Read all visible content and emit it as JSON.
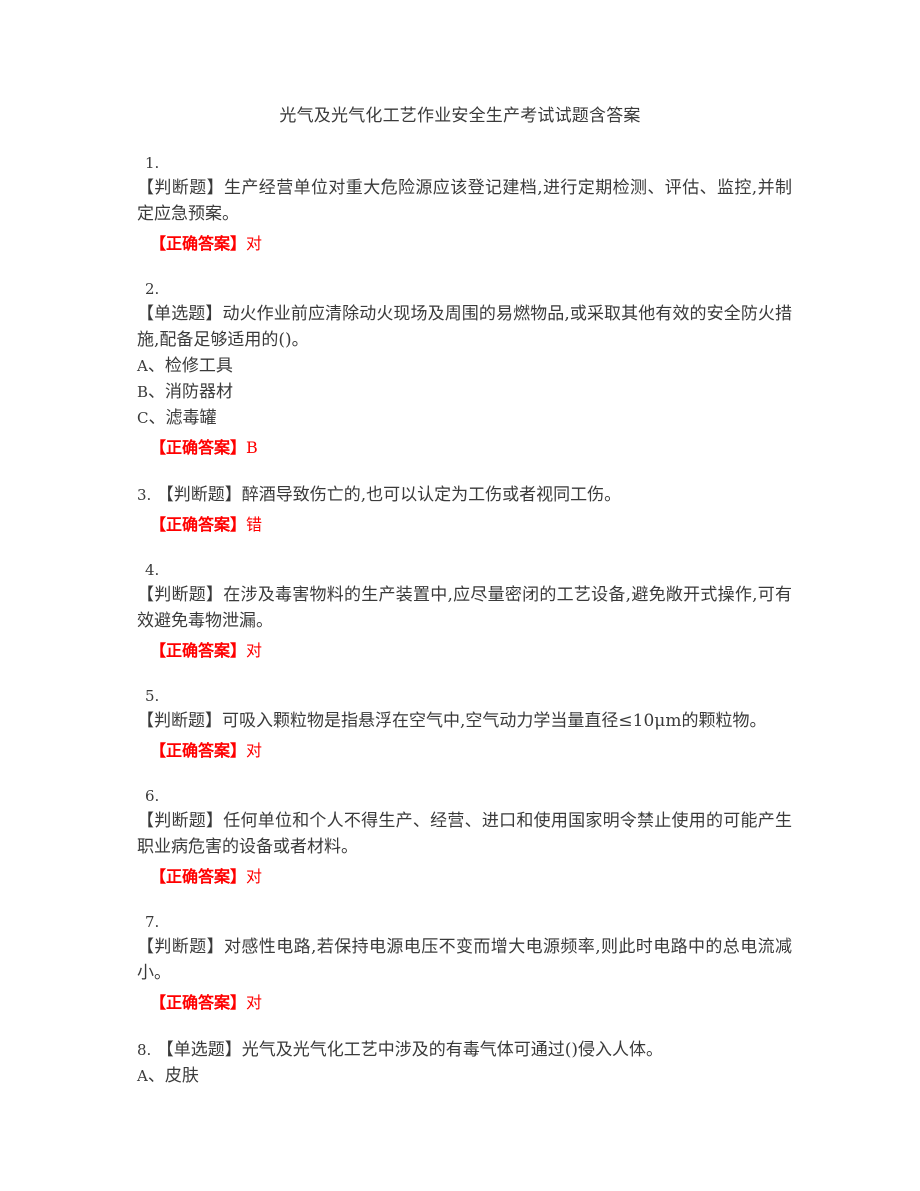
{
  "document": {
    "title": "光气及光气化工艺作业安全生产考试试题含答案",
    "answer_label": "【正确答案】",
    "accent_color": "#ff0000",
    "text_color": "#3a3a3a",
    "background_color": "#ffffff"
  },
  "questions": [
    {
      "number": "1.",
      "inline": false,
      "type_tag": "【判断题】",
      "text": "生产经营单位对重大危险源应该登记建档,进行定期检测、评估、监控,并制定应急预案。",
      "options": [],
      "answer": "对"
    },
    {
      "number": "2.",
      "inline": false,
      "type_tag": "【单选题】",
      "text": "动火作业前应清除动火现场及周围的易燃物品,或采取其他有效的安全防火措施,配备足够适用的()。",
      "options": [
        {
          "letter": "A",
          "separator": "、",
          "label": "检修工具"
        },
        {
          "letter": "B",
          "separator": "、",
          "label": "消防器材"
        },
        {
          "letter": "C",
          "separator": "、",
          "label": "滤毒罐"
        }
      ],
      "answer": "B"
    },
    {
      "number": "3.",
      "inline": true,
      "type_tag": "【判断题】",
      "text": "醉酒导致伤亡的,也可以认定为工伤或者视同工伤。",
      "options": [],
      "answer": "错"
    },
    {
      "number": "4.",
      "inline": false,
      "type_tag": "【判断题】",
      "text": "在涉及毒害物料的生产装置中,应尽量密闭的工艺设备,避免敞开式操作,可有效避免毒物泄漏。",
      "options": [],
      "answer": "对"
    },
    {
      "number": "5.",
      "inline": false,
      "type_tag": "【判断题】",
      "text": "可吸入颗粒物是指悬浮在空气中,空气动力学当量直径≤10μm的颗粒物。",
      "options": [],
      "answer": "对"
    },
    {
      "number": "6.",
      "inline": false,
      "type_tag": "【判断题】",
      "text": "任何单位和个人不得生产、经营、进口和使用国家明令禁止使用的可能产生职业病危害的设备或者材料。",
      "options": [],
      "answer": "对"
    },
    {
      "number": "7.",
      "inline": false,
      "type_tag": "【判断题】",
      "text": "对感性电路,若保持电源电压不变而增大电源频率,则此时电路中的总电流减小。",
      "options": [],
      "answer": "对"
    },
    {
      "number": "8.",
      "inline": true,
      "type_tag": "【单选题】",
      "text": "光气及光气化工艺中涉及的有毒气体可通过()侵入人体。",
      "options": [
        {
          "letter": "A",
          "separator": "、",
          "label": "皮肤"
        }
      ],
      "answer": null
    }
  ]
}
